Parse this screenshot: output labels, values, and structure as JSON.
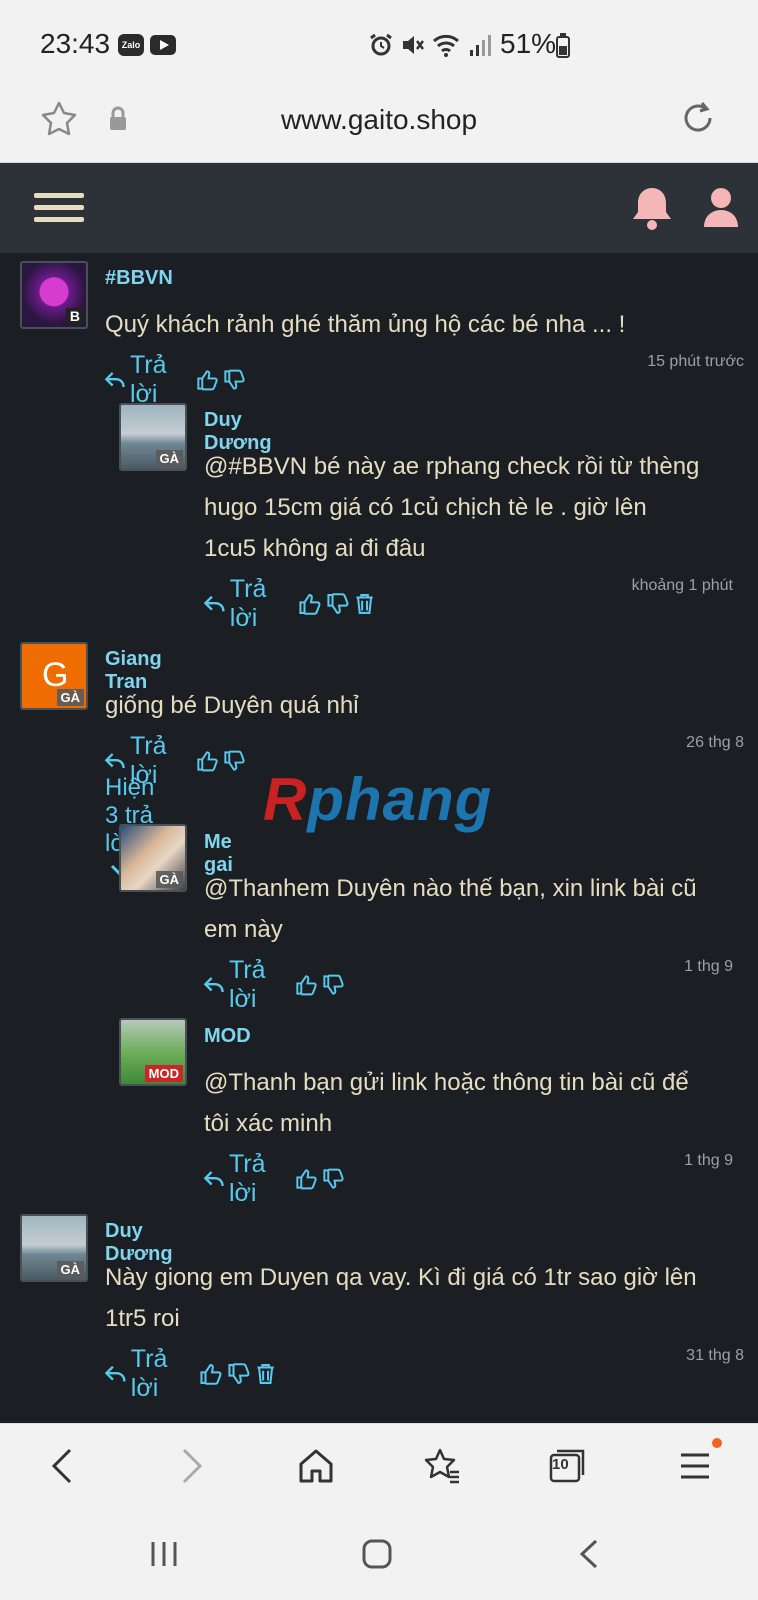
{
  "status_bar": {
    "time": "23:43",
    "zalo": "Zalo",
    "battery": "51%",
    "icons": [
      "alarm-icon",
      "mute-icon",
      "wifi-icon",
      "signal-icon",
      "battery-icon"
    ]
  },
  "browser": {
    "url": "www.gaito.shop"
  },
  "comments": [
    {
      "user": "#BBVN",
      "text": "Quý khách rảnh ghé thăm ủng hộ các bé nha ... !",
      "reply_label": "Trả lời",
      "time": "15 phút trước"
    },
    {
      "user": "Duy Dương",
      "badge": "GÀ",
      "text_lines": [
        "@#BBVN bé này ae rphang check rồi từ thèng",
        "hugo 15cm giá có 1củ chịch tè le . giờ lên",
        "1cu5 không ai đi đâu"
      ],
      "reply_label": "Trả lời",
      "time": "khoảng 1 phút"
    },
    {
      "user": "Giang Tran",
      "badge": "GÀ",
      "avatar_letter": "G",
      "text": "giống bé Duyên quá nhỉ",
      "reply_label": "Trả lời",
      "time": "26 thg 8",
      "show_replies": "Hiện 3 trả lời"
    },
    {
      "user": "Me gai",
      "badge": "GÀ",
      "text_lines": [
        "@Thanhem Duyên nào thế bạn, xin link bài cũ",
        "em này"
      ],
      "reply_label": "Trả lời",
      "time": "1 thg 9"
    },
    {
      "user": "MOD",
      "badge": "MOD",
      "text_lines": [
        "@Thanh bạn gửi link hoặc thông tin bài cũ để",
        "tôi xác minh"
      ],
      "reply_label": "Trả lời",
      "time": "1 thg 9"
    },
    {
      "user": "Duy Dương",
      "badge": "GÀ",
      "text_lines": [
        "Này giong em Duyen qa vay. Kì đi giá có 1tr sao giờ lên",
        "1tr5 roi"
      ],
      "reply_label": "Trả lời",
      "time": "31 thg 8"
    }
  ],
  "watermark": {
    "r": "R",
    "rest": "phang"
  },
  "bottom_nav": {
    "tab_count": "10"
  },
  "colors": {
    "background": "#1b1f24",
    "header": "#2c3238",
    "username": "#7fd4ee",
    "text": "#e6dcc0",
    "link": "#58c8ec",
    "bell": "#f4b6b6"
  }
}
